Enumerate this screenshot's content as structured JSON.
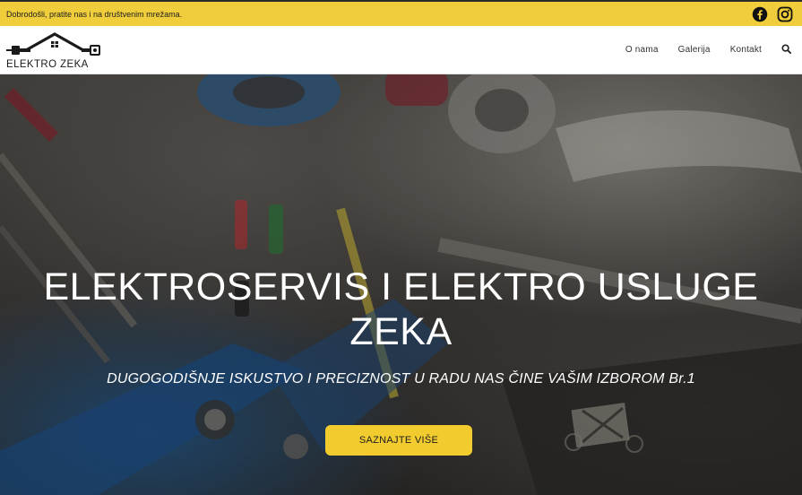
{
  "topbar": {
    "message": "Dobrodošli, pratite nas i na društvenim mrežama.",
    "background": "#f0cd3a",
    "social_icons": [
      "facebook-icon",
      "instagram-icon"
    ]
  },
  "header": {
    "logo_text": "ELEKTRO ZEKA",
    "nav": [
      "O nama",
      "Galerija",
      "Kontakt"
    ],
    "search_icon": "search-icon"
  },
  "hero": {
    "title_line1": "ELEKTROSERVIS I ELEKTRO USLUGE",
    "title_line2": "ZEKA",
    "subtitle": "DUGOGODIŠNJE ISKUSTVO I PRECIZNOST U RADU NAS ČINE VAŠIM IZBOROM Br.1",
    "cta_label": "SAZNAJTE VIŠE",
    "cta_color": "#f2cc2e"
  }
}
